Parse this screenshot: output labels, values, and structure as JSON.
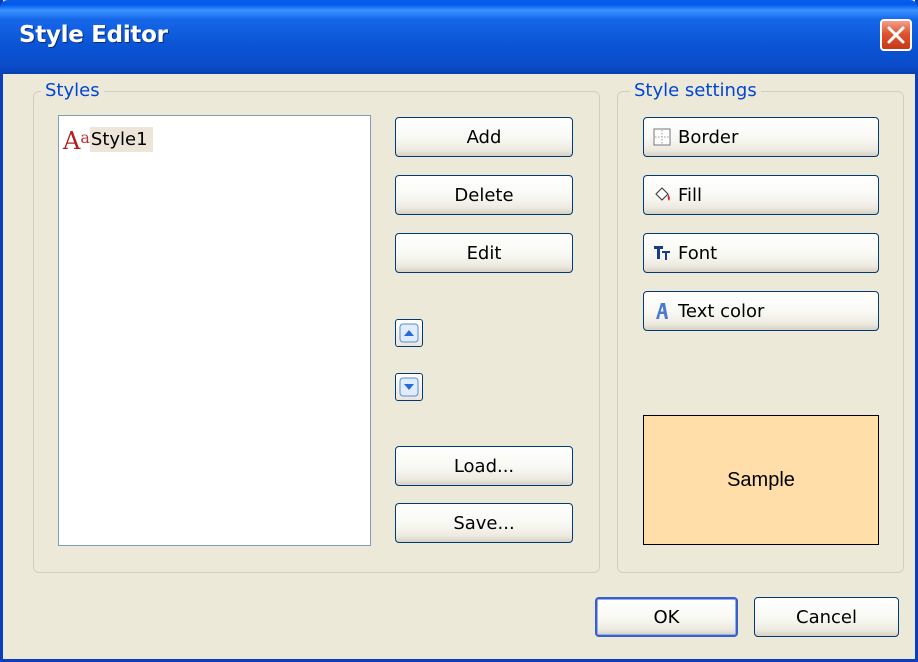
{
  "window": {
    "title": "Style Editor"
  },
  "styles_group": {
    "label": "Styles",
    "items": [
      {
        "label": "Style1",
        "icon": "style-aa-icon"
      }
    ]
  },
  "style_buttons": {
    "add": "Add",
    "delete": "Delete",
    "edit": "Edit",
    "load": "Load...",
    "save": "Save..."
  },
  "settings_group": {
    "label": "Style settings",
    "border": "Border",
    "fill": "Fill",
    "font": "Font",
    "text_color": "Text color"
  },
  "sample": {
    "text": "Sample",
    "background": "#ffdeaa"
  },
  "footer": {
    "ok": "OK",
    "cancel": "Cancel"
  },
  "colors": {
    "titlebar": "#0a55d6",
    "face": "#ece9d8",
    "group_label": "#0046d5",
    "close": "#e0532e"
  }
}
